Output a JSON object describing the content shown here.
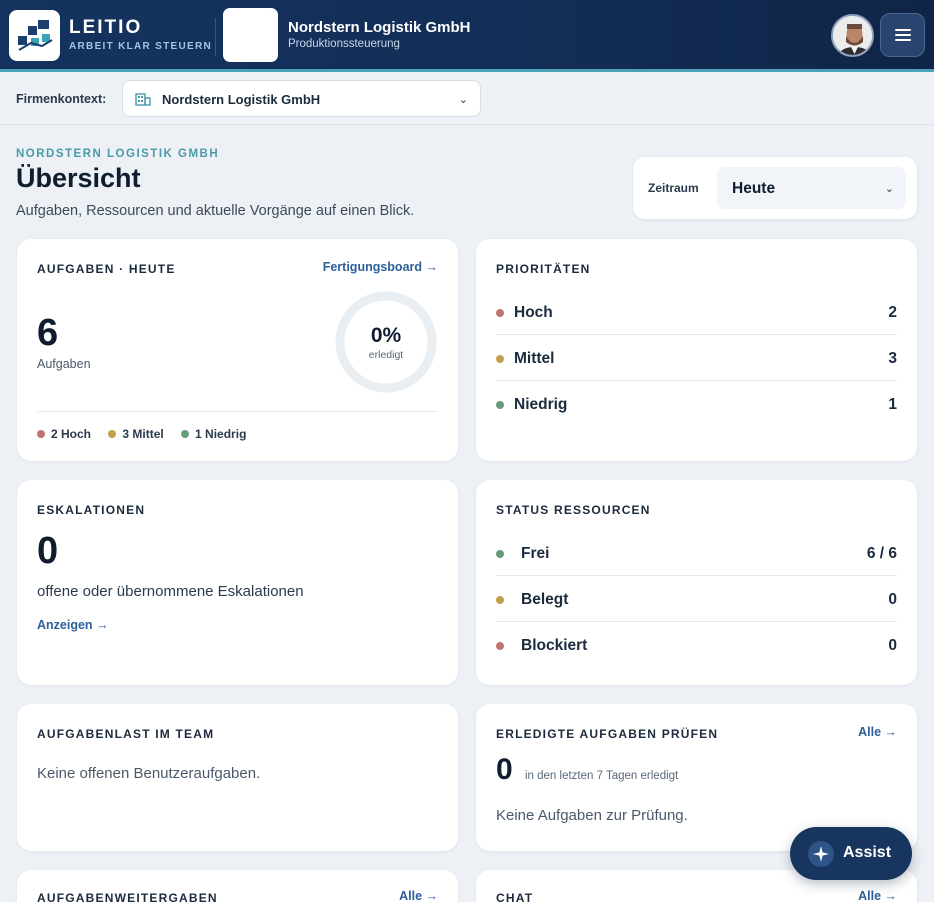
{
  "header": {
    "brand_name": "LEITIO",
    "brand_tagline": "ARBEIT KLAR STEUERN",
    "company_name": "Nordstern Logistik GmbH",
    "company_subtitle": "Produktionssteuerung",
    "menu_icon": "hamburger-icon"
  },
  "context": {
    "label": "Firmenkontext:",
    "selected": "Nordstern Logistik GmbH",
    "icon": "building-icon"
  },
  "page": {
    "eyebrow": "NORDSTERN LOGISTIK GMBH",
    "title": "Übersicht",
    "subtitle": "Aufgaben, Ressourcen und aktuelle Vorgänge auf einen Blick.",
    "range_label": "Zeitraum",
    "range_value": "Heute"
  },
  "tasks_card": {
    "title": "AUFGABEN · HEUTE",
    "link": "Fertigungsboard →",
    "count": "6",
    "count_label": "Aufgaben",
    "percent": "0%",
    "percent_label": "erledigt",
    "done_fraction": 0,
    "legend": [
      {
        "label": "2 Hoch",
        "color": "#c0736f"
      },
      {
        "label": "3 Mittel",
        "color": "#c3a04f"
      },
      {
        "label": "1 Niedrig",
        "color": "#6a9a7c"
      }
    ]
  },
  "priorities_card": {
    "title": "PRIORITÄTEN",
    "rows": [
      {
        "name": "Hoch",
        "count": "2",
        "color": "#c0736f"
      },
      {
        "name": "Mittel",
        "count": "3",
        "color": "#c3a04f"
      },
      {
        "name": "Niedrig",
        "count": "1",
        "color": "#6a9a7c"
      }
    ]
  },
  "escalations_card": {
    "title": "ESKALATIONEN",
    "count": "0",
    "description": "offene oder übernommene Eskalationen",
    "link": "Anzeigen →"
  },
  "resources_card": {
    "title": "STATUS RESSOURCEN",
    "rows": [
      {
        "name": "Frei",
        "count": "6 / 6",
        "color": "#6a9a7c"
      },
      {
        "name": "Belegt",
        "count": "0",
        "color": "#c3a04f"
      },
      {
        "name": "Blockiert",
        "count": "0",
        "color": "#c0736f"
      }
    ]
  },
  "team_load_card": {
    "title": "AUFGABENLAST IM TEAM",
    "empty_text": "Keine offenen Benutzeraufgaben."
  },
  "review_card": {
    "title": "ERLEDIGTE AUFGABEN PRÜFEN",
    "link": "Alle →",
    "count": "0",
    "count_label": "in den letzten 7 Tagen erledigt",
    "empty_text": "Keine Aufgaben zur Prüfung."
  },
  "handover_card": {
    "title": "AUFGABENWEITERGABEN",
    "link": "Alle →"
  },
  "chat_card": {
    "title": "CHAT",
    "link": "Alle →"
  },
  "assist": {
    "label": "Assist"
  }
}
